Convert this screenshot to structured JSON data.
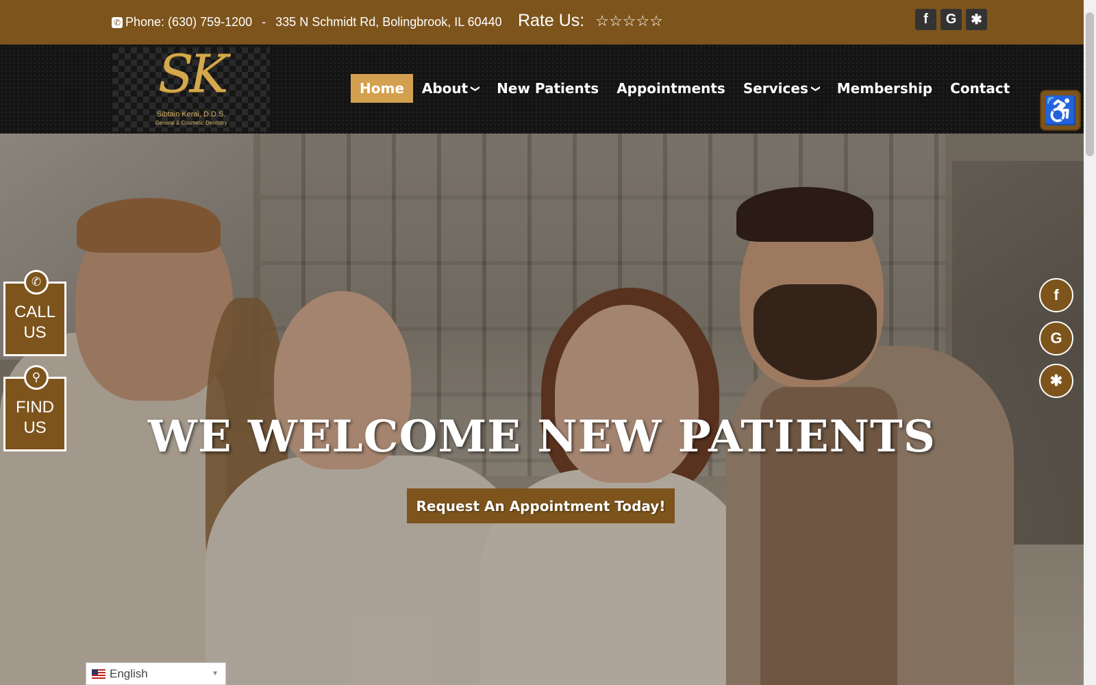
{
  "topbar": {
    "phone": "Phone: (630) 759-1200",
    "separator": "-",
    "address": "335 N Schmidt Rd, Bolingbrook, IL 60440",
    "rate_label": "Rate Us:",
    "stars": "☆☆☆☆☆",
    "social": [
      {
        "icon": "facebook-icon",
        "glyph": "f"
      },
      {
        "icon": "google-icon",
        "glyph": "G"
      },
      {
        "icon": "yelp-icon",
        "glyph": "✱"
      }
    ]
  },
  "logo": {
    "monogram": "SK",
    "name": "Sibtain Kerai, D.D.S.",
    "tagline": "General & Cosmetic Dentistry"
  },
  "nav": {
    "items": [
      {
        "label": "Home",
        "active": true
      },
      {
        "label": "About",
        "dropdown": true
      },
      {
        "label": "New Patients"
      },
      {
        "label": "Appointments"
      },
      {
        "label": "Services",
        "dropdown": true
      },
      {
        "label": "Membership"
      },
      {
        "label": "Contact"
      }
    ]
  },
  "accessibility": {
    "icon": "wheelchair-icon",
    "glyph": "♿"
  },
  "hero": {
    "title": "WE WELCOME NEW PATIENTS",
    "button": "Request An Appointment Today!"
  },
  "side_tabs": {
    "call": {
      "label_line1": "CALL",
      "label_line2": "US",
      "icon": "phone-icon",
      "glyph": "✆"
    },
    "find": {
      "label_line1": "FIND",
      "label_line2": "US",
      "icon": "map-pin-icon",
      "glyph": "⚲"
    }
  },
  "right_social": [
    {
      "icon": "facebook-icon",
      "glyph": "f"
    },
    {
      "icon": "google-icon",
      "glyph": "G"
    },
    {
      "icon": "yelp-icon",
      "glyph": "✱"
    }
  ],
  "language": {
    "value": "English",
    "caret": "▼"
  },
  "colors": {
    "brand": "#7d541c",
    "active_nav": "#d3a050",
    "nav_bg": "#141414"
  }
}
